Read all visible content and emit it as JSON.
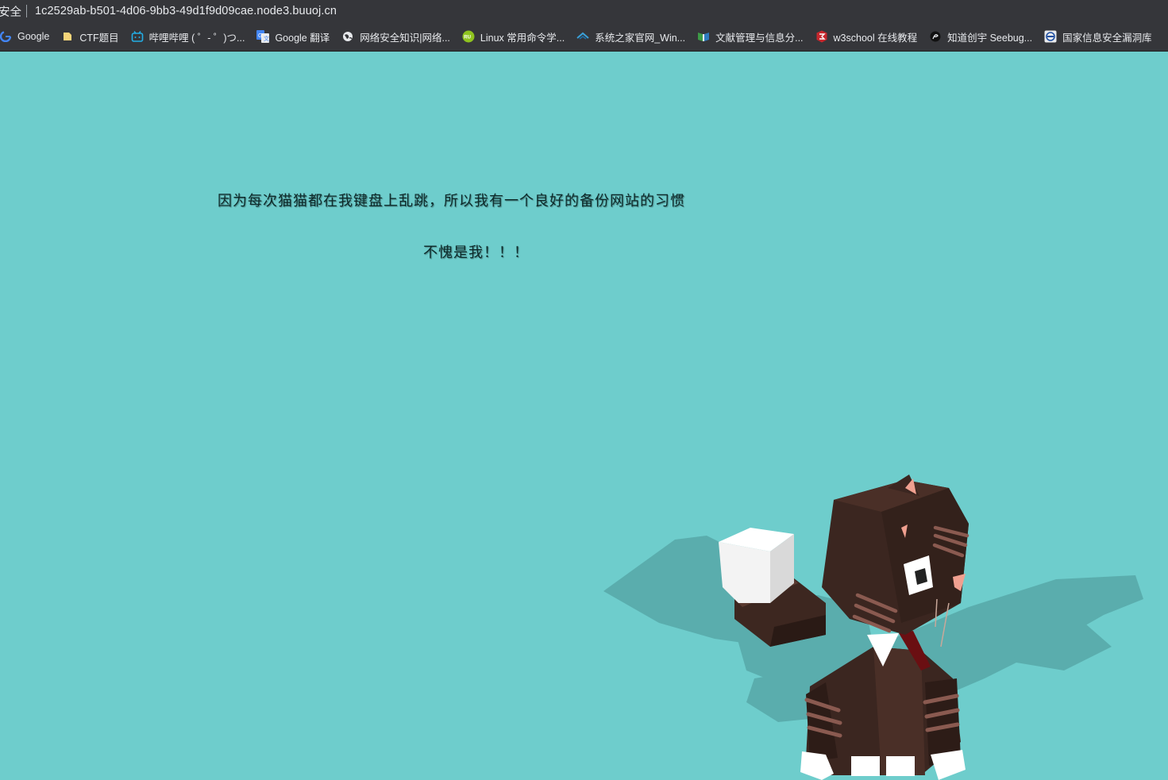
{
  "browser": {
    "security_label": "安全",
    "url": "1c2529ab-b501-4d06-9bb3-49d1f9d09cae.node3.buuoj.cn"
  },
  "bookmarks": [
    {
      "label": "Google",
      "icon": "google-icon"
    },
    {
      "label": "CTF题目",
      "icon": "folder-icon"
    },
    {
      "label": "哔哩哔哩 ( ゜- ゜)つ...",
      "icon": "bilibili-icon"
    },
    {
      "label": "Google 翻译",
      "icon": "translate-icon"
    },
    {
      "label": "网络安全知识|网络...",
      "icon": "globe-icon"
    },
    {
      "label": "Linux 常用命令学...",
      "icon": "linux-icon"
    },
    {
      "label": "系统之家官网_Win...",
      "icon": "xitong-icon"
    },
    {
      "label": "文献管理与信息分...",
      "icon": "book-icon"
    },
    {
      "label": "w3school 在线教程",
      "icon": "w3school-icon"
    },
    {
      "label": "知道创宇 Seebug...",
      "icon": "seebug-icon"
    },
    {
      "label": "国家信息安全漏洞库",
      "icon": "cnnvd-icon"
    }
  ],
  "page": {
    "background": "#6ecdcc",
    "message_line1": "因为每次猫猫都在我键盘上乱跳，所以我有一个良好的备份网站的习惯",
    "message_line2": "不愧是我！！！"
  },
  "illustration": {
    "name": "voxel cat holding white cube",
    "colors": {
      "fur_dark": "#3b2620",
      "fur_mid": "#4a2f27",
      "stripes": "#8a5a50",
      "white": "#ffffff",
      "shadow": "#56a6a6",
      "ear_pink": "#f0a090"
    }
  }
}
